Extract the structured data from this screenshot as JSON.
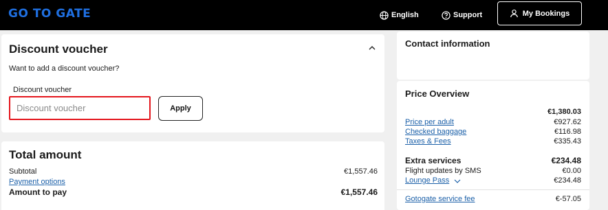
{
  "header": {
    "logo_text": "GO TO GATE",
    "language_label": "English",
    "support_label": "Support",
    "bookings_label": "My Bookings"
  },
  "voucher": {
    "title": "Discount voucher",
    "prompt": "Want to add a discount voucher?",
    "field_label": "Discount voucher",
    "placeholder": "Discount voucher",
    "value": "",
    "apply_label": "Apply"
  },
  "total": {
    "title": "Total amount",
    "subtotal_label": "Subtotal",
    "subtotal_value": "€1,557.46",
    "payment_options_label": "Payment options",
    "amount_label": "Amount to pay",
    "amount_value": "€1,557.46"
  },
  "contact": {
    "title": "Contact information"
  },
  "price": {
    "title": "Price Overview",
    "flight_total": "€1,380.03",
    "lines": [
      {
        "label": "Price per adult",
        "value": "€927.62"
      },
      {
        "label": "Checked baggage",
        "value": "€116.98"
      },
      {
        "label": "Taxes & Fees",
        "value": "€335.43"
      }
    ],
    "extras_label": "Extra services",
    "extras_total": "€234.48",
    "sms_label": "Flight updates by SMS",
    "sms_value": "€0.00",
    "lounge_label": "Lounge Pass",
    "lounge_value": "€234.48",
    "service_fee_label": "Gotogate service fee",
    "service_fee_value": "€-57.05"
  },
  "colors": {
    "header_bg": "#000000",
    "logo": "#1f6fe0",
    "link": "#1a5fa8",
    "error_border": "#e4141b"
  },
  "icons": {
    "language": "globe-icon",
    "support": "help-circle-icon",
    "bookings": "user-icon",
    "collapse": "chevron-up-icon",
    "lounge": "chevron-down-icon"
  }
}
